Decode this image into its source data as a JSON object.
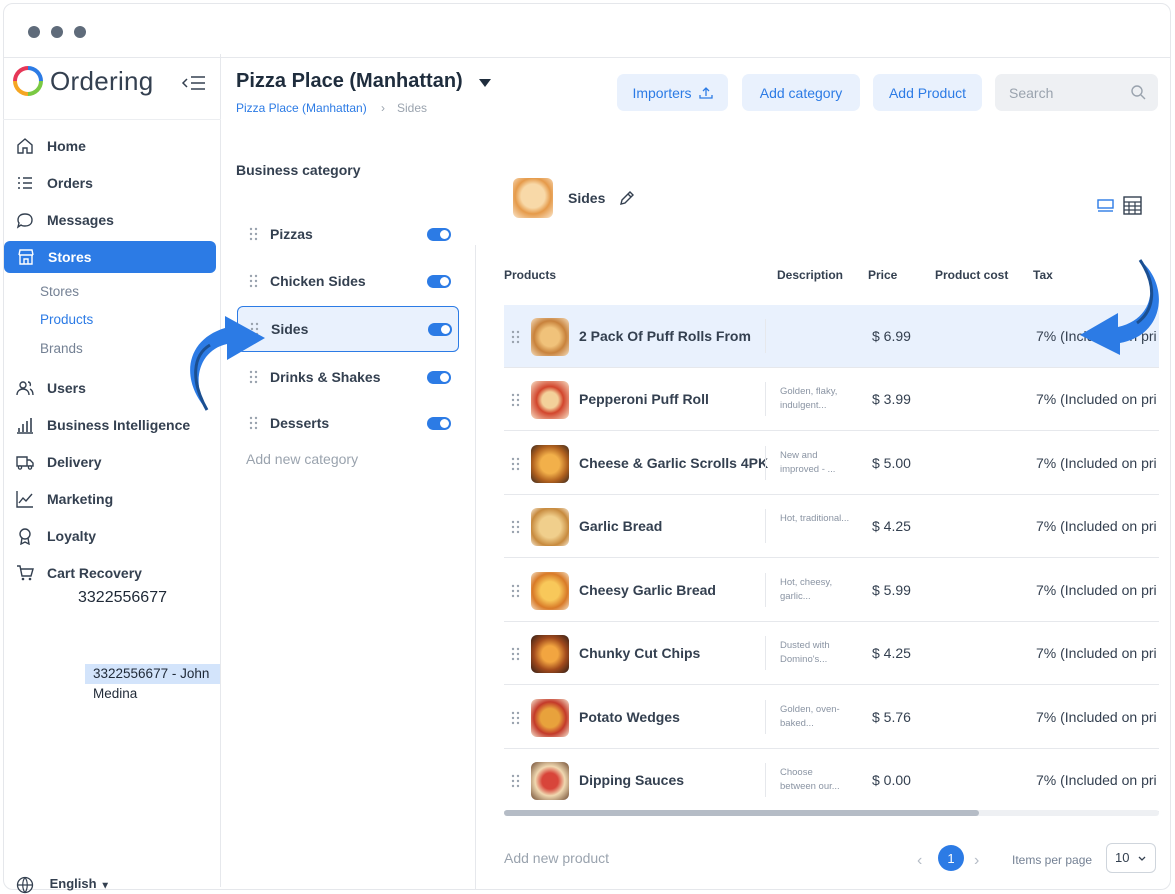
{
  "app": {
    "name": "Ordering"
  },
  "sidebar": {
    "items": [
      {
        "label": "Home",
        "icon": "home-icon"
      },
      {
        "label": "Orders",
        "icon": "list-icon"
      },
      {
        "label": "Messages",
        "icon": "chat-icon"
      },
      {
        "label": "Stores",
        "icon": "store-icon",
        "active": true
      },
      {
        "label": "Users",
        "icon": "users-icon"
      },
      {
        "label": "Business Intelligence",
        "icon": "bar-chart-icon"
      },
      {
        "label": "Delivery",
        "icon": "truck-icon"
      },
      {
        "label": "Marketing",
        "icon": "line-chart-icon"
      },
      {
        "label": "Loyalty",
        "icon": "award-icon"
      },
      {
        "label": "Cart Recovery",
        "icon": "cart-icon"
      }
    ],
    "subitems": [
      {
        "label": "Stores"
      },
      {
        "label": "Products",
        "active": true
      },
      {
        "label": "Brands"
      }
    ],
    "phone_text": "3322556677",
    "phone_chip": "3322556677 - John Medina",
    "language": "English"
  },
  "header": {
    "title": "Pizza Place (Manhattan)",
    "breadcrumb": [
      "Pizza Place (Manhattan)",
      "Sides"
    ],
    "buttons": {
      "importers": "Importers",
      "add_category": "Add category",
      "add_product": "Add Product"
    },
    "search_placeholder": "Search"
  },
  "categories": {
    "heading": "Business category",
    "items": [
      {
        "label": "Pizzas",
        "enabled": true
      },
      {
        "label": "Chicken Sides",
        "enabled": true
      },
      {
        "label": "Sides",
        "enabled": true,
        "selected": true
      },
      {
        "label": "Drinks & Shakes",
        "enabled": true
      },
      {
        "label": "Desserts",
        "enabled": true
      }
    ],
    "add_label": "Add new category"
  },
  "products": {
    "selected_category": "Sides",
    "columns": [
      "Products",
      "Description",
      "Price",
      "Product cost",
      "Tax"
    ],
    "rows": [
      {
        "name": "2 Pack Of Puff Rolls From",
        "description": "",
        "price": "$ 6.99",
        "tax": "7% (Included on pri"
      },
      {
        "name": "Pepperoni Puff Roll",
        "description": "Golden, flaky, indulgent...",
        "price": "$ 3.99",
        "tax": "7% (Included on pri"
      },
      {
        "name": "Cheese & Garlic Scrolls 4PK",
        "description": "New and improved - ...",
        "price": "$ 5.00",
        "tax": "7% (Included on pri"
      },
      {
        "name": "Garlic Bread",
        "description": "Hot, traditional...",
        "price": "$ 4.25",
        "tax": "7% (Included on pri"
      },
      {
        "name": "Cheesy Garlic Bread",
        "description": "Hot, cheesy, garlic...",
        "price": "$ 5.99",
        "tax": "7% (Included on pri"
      },
      {
        "name": "Chunky Cut Chips",
        "description": "Dusted with Domino's...",
        "price": "$ 4.25",
        "tax": "7% (Included on pri"
      },
      {
        "name": "Potato Wedges",
        "description": "Golden, oven-baked...",
        "price": "$ 5.76",
        "tax": "7% (Included on pri"
      },
      {
        "name": "Dipping Sauces",
        "description": "Choose between our...",
        "price": "$ 0.00",
        "tax": "7% (Included on pri"
      }
    ],
    "add_label": "Add new product",
    "pagination": {
      "current": "1",
      "items_per_page_label": "Items per page",
      "items_per_page": "10"
    }
  },
  "colors": {
    "accent": "#2c7be5",
    "accent_light": "#e9f1fd",
    "text": "#344050",
    "muted": "#9aa3ae",
    "arrow": "#2c7be5"
  }
}
